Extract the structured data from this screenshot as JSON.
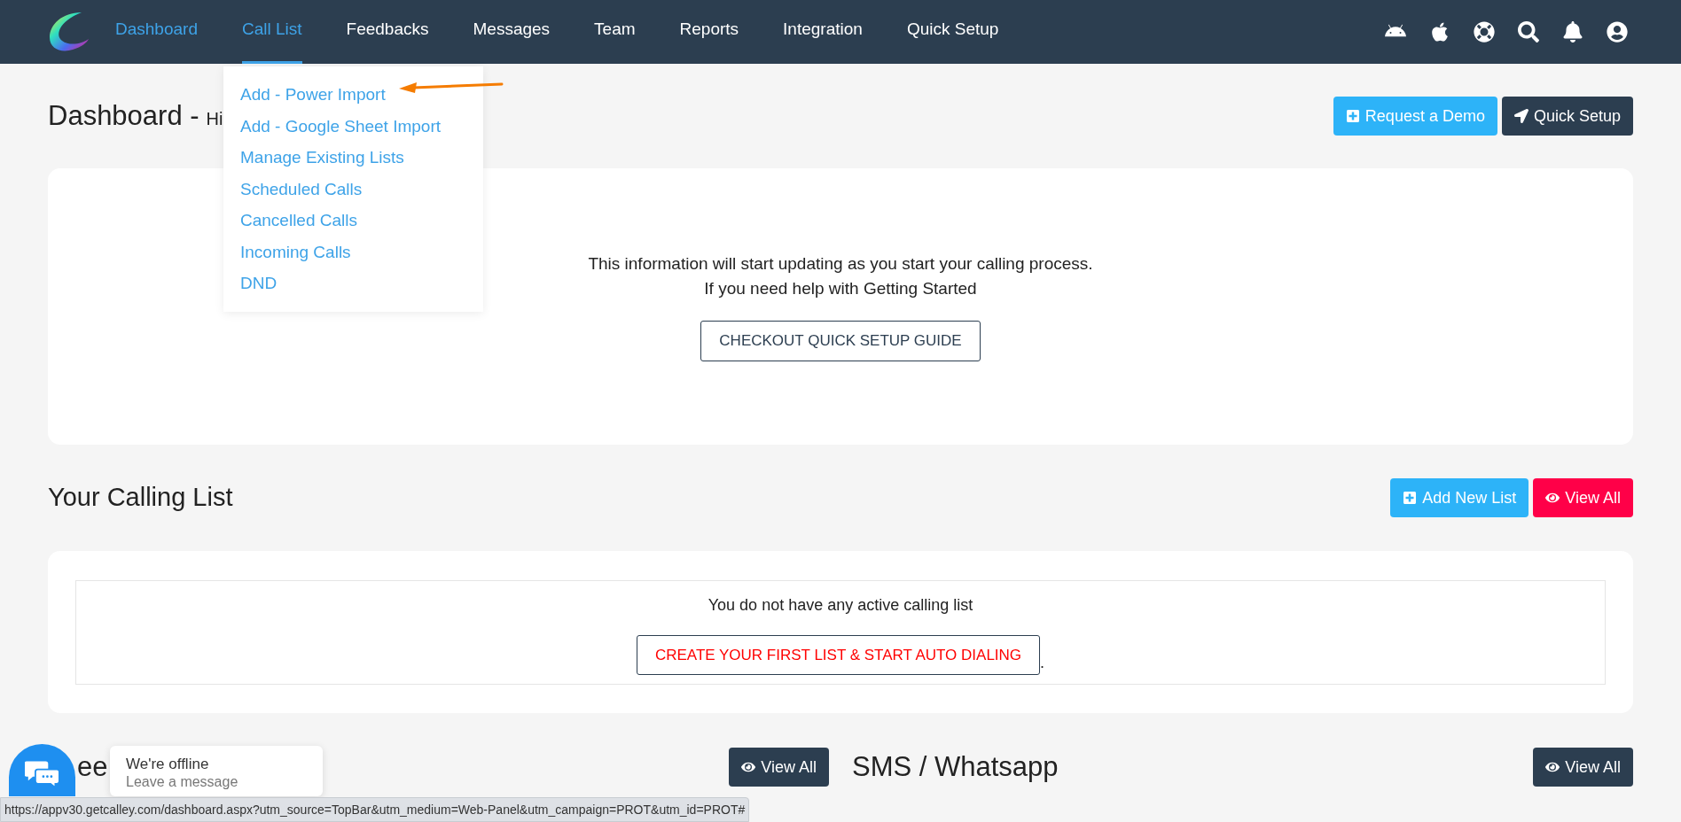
{
  "nav": {
    "items": [
      {
        "label": "Dashboard",
        "highlighted": true,
        "expanded": false
      },
      {
        "label": "Call List",
        "highlighted": true,
        "expanded": true
      },
      {
        "label": "Feedbacks",
        "highlighted": false,
        "expanded": false
      },
      {
        "label": "Messages",
        "highlighted": false,
        "expanded": false
      },
      {
        "label": "Team",
        "highlighted": false,
        "expanded": false
      },
      {
        "label": "Reports",
        "highlighted": false,
        "expanded": false
      },
      {
        "label": "Integration",
        "highlighted": false,
        "expanded": false
      },
      {
        "label": "Quick Setup",
        "highlighted": false,
        "expanded": false
      }
    ],
    "icons": [
      {
        "kind": "android"
      },
      {
        "kind": "apple"
      },
      {
        "kind": "help"
      },
      {
        "kind": "search"
      },
      {
        "kind": "bell"
      },
      {
        "kind": "user"
      }
    ]
  },
  "dropdown": {
    "items": [
      "Add - Power Import",
      "Add - Google Sheet Import",
      "Manage Existing Lists",
      "Scheduled Calls",
      "Cancelled Calls",
      "Incoming Calls",
      "DND"
    ]
  },
  "header": {
    "title": "Dashboard -",
    "greeting": "Hi",
    "buttons": [
      {
        "label": "Request a Demo",
        "kind": "demo"
      },
      {
        "label": "Quick Setup",
        "kind": "setup"
      }
    ]
  },
  "info_card": {
    "lines": [
      "This information will start updating as you start your calling process.",
      "If you need help with Getting Started"
    ],
    "button": "CHECKOUT QUICK SETUP GUIDE"
  },
  "calling_list": {
    "title": "Your Calling List",
    "buttons": [
      {
        "label": "Add New List",
        "kind": "add"
      },
      {
        "label": "View All",
        "kind": "view"
      }
    ],
    "empty_text": "You do not have any active calling list",
    "button": "CREATE YOUR FIRST LIST & START AUTO DIALING",
    "suffix": "."
  },
  "bottom_sections": [
    {
      "title": "ee",
      "button": "View All"
    },
    {
      "title": "SMS / Whatsapp",
      "button": "View All"
    }
  ],
  "chat": {
    "title": "We're offline",
    "subtitle": "Leave a message"
  },
  "status_bar": {
    "url": "https://appv30.getcalley.com/dashboard.aspx?utm_source=TopBar&utm_medium=Web-Panel&utm_campaign=PROT&utm_id=PROT#"
  }
}
